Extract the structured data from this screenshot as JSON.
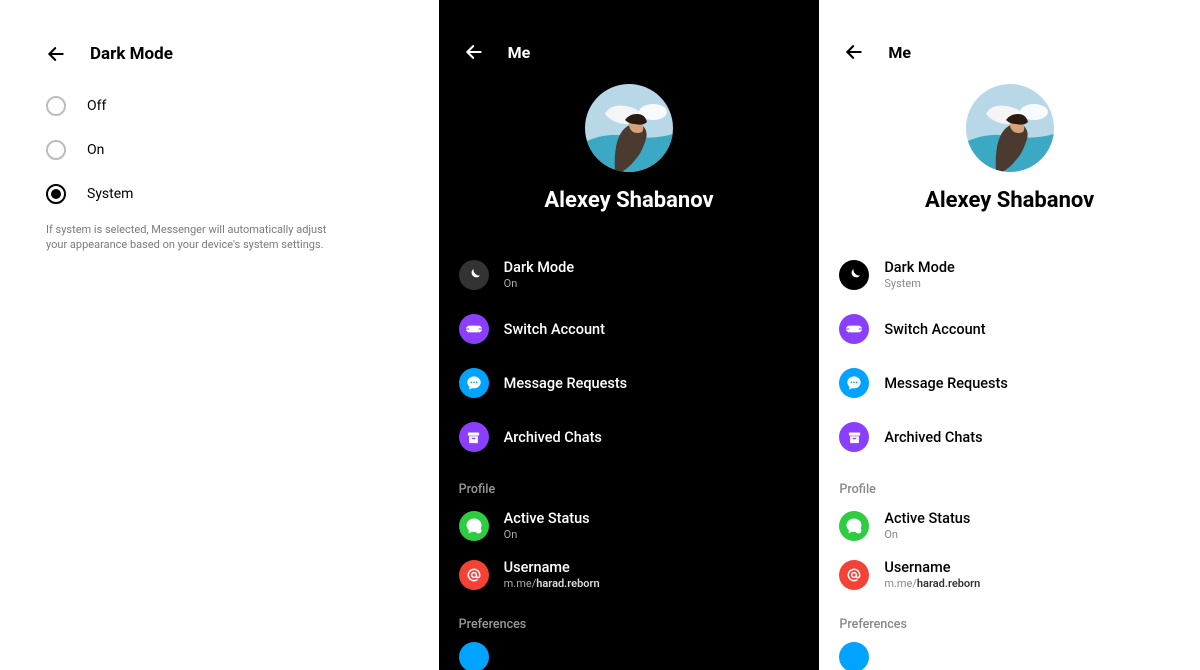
{
  "panel1": {
    "title": "Dark Mode",
    "options": {
      "off": "Off",
      "on": "On",
      "system": "System"
    },
    "note": "If system is selected, Messenger will automatically adjust your appearance based on your device's system settings."
  },
  "meDark": {
    "headerTitle": "Me",
    "name": "Alexey Shabanov",
    "darkMode": {
      "label": "Dark Mode",
      "sub": "On"
    },
    "switchAccount": "Switch Account",
    "messageRequests": "Message Requests",
    "archivedChats": "Archived Chats",
    "sectionProfile": "Profile",
    "activeStatus": {
      "label": "Active Status",
      "sub": "On"
    },
    "username": {
      "label": "Username",
      "prefix": "m.me/",
      "value": "harad.reborn"
    },
    "sectionPreferences": "Preferences"
  },
  "meLight": {
    "headerTitle": "Me",
    "name": "Alexey Shabanov",
    "darkMode": {
      "label": "Dark Mode",
      "sub": "System"
    },
    "switchAccount": "Switch Account",
    "messageRequests": "Message Requests",
    "archivedChats": "Archived Chats",
    "sectionProfile": "Profile",
    "activeStatus": {
      "label": "Active Status",
      "sub": "On"
    },
    "username": {
      "label": "Username",
      "prefix": "m.me/",
      "value": "harad.reborn"
    },
    "sectionPreferences": "Preferences"
  },
  "colors": {
    "purple": "#8a3ffc",
    "blue": "#00a3ff",
    "green": "#2ecc40",
    "red": "#f44336",
    "darkIconBg": "#333",
    "black": "#000"
  }
}
